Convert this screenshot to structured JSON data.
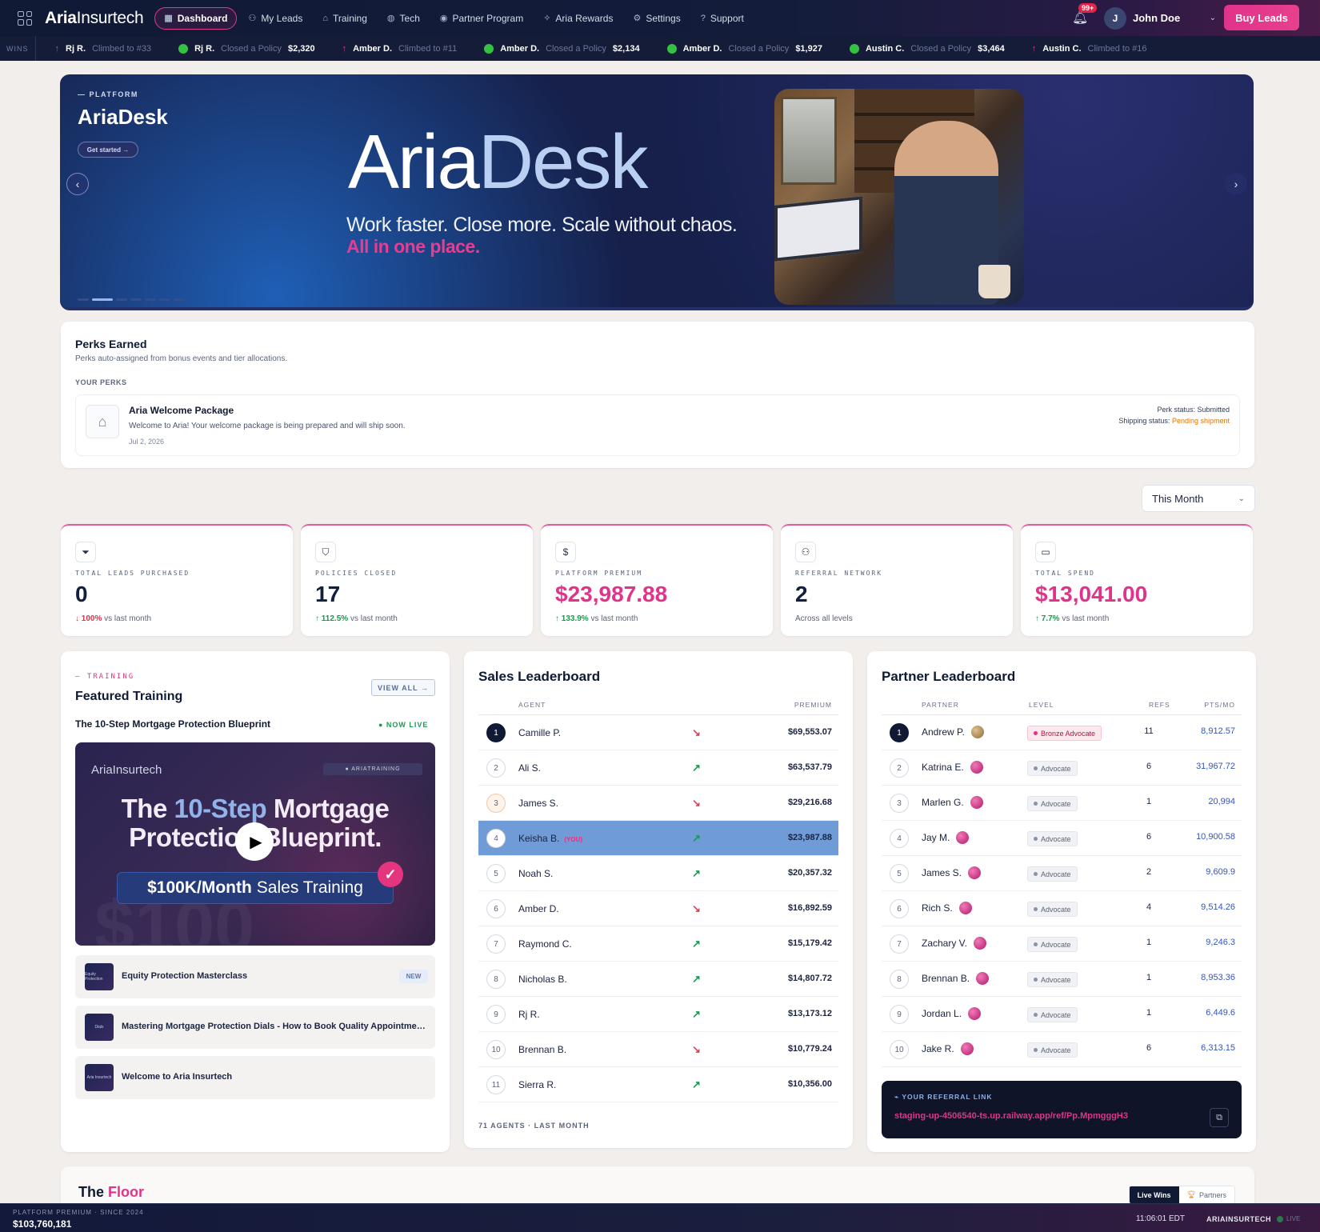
{
  "nav": {
    "brand_bold": "Aria",
    "brand_rest": "Insurtech",
    "items": [
      {
        "label": "Dashboard",
        "icon": "dashboard-icon",
        "active": true
      },
      {
        "label": "My Leads",
        "icon": "users-icon"
      },
      {
        "label": "Training",
        "icon": "graduation-cap-icon"
      },
      {
        "label": "Tech",
        "icon": "globe-icon"
      },
      {
        "label": "Partner Program",
        "icon": "user-circle-icon"
      },
      {
        "label": "Aria Rewards",
        "icon": "sparkles-icon"
      },
      {
        "label": "Settings",
        "icon": "gear-icon"
      },
      {
        "label": "Support",
        "icon": "help-circle-icon"
      }
    ],
    "notifications": "99+",
    "user_initial": "J",
    "user_name": "John Doe",
    "buy_label": "Buy Leads"
  },
  "ticker": {
    "label": "WINS",
    "items": [
      {
        "kind": "climb",
        "name": "Rj R.",
        "action": "Climbed to #33",
        "value": ""
      },
      {
        "kind": "close",
        "name": "Rj R.",
        "action": "Closed a Policy",
        "value": "$2,320"
      },
      {
        "kind": "climb",
        "name": "Amber D.",
        "action": "Climbed to #11",
        "value": ""
      },
      {
        "kind": "close",
        "name": "Amber D.",
        "action": "Closed a Policy",
        "value": "$2,134"
      },
      {
        "kind": "close",
        "name": "Amber D.",
        "action": "Closed a Policy",
        "value": "$1,927"
      },
      {
        "kind": "close",
        "name": "Austin C.",
        "action": "Closed a Policy",
        "value": "$3,464"
      },
      {
        "kind": "climb",
        "name": "Austin C.",
        "action": "Climbed to #16",
        "value": ""
      }
    ]
  },
  "hero": {
    "kicker": "— PLATFORM",
    "title": "AriaDesk",
    "cta": "Get started →",
    "big_aria": "Aria",
    "big_desk": "Desk",
    "subtitle": "Work faster. Close more. Scale without chaos.",
    "subtitle_accent": "All in one place.",
    "slides": 7,
    "active_slide": 2
  },
  "perks": {
    "title": "Perks Earned",
    "description": "Perks auto-assigned from bonus events and tier allocations.",
    "section_label": "YOUR PERKS",
    "item": {
      "title": "Aria Welcome Package",
      "description": "Welcome to Aria! Your welcome package is being prepared and will ship soon.",
      "date": "Jul 2, 2026",
      "status_label": "Perk status: Submitted",
      "shipping_label": "Shipping status:",
      "shipping_value": "Pending shipment"
    }
  },
  "period": {
    "selected": "This Month"
  },
  "stats": [
    {
      "label": "TOTAL LEADS PURCHASED",
      "value": "0",
      "change": "100%",
      "direction": "down",
      "suffix": "vs last month",
      "icon": "filter-icon",
      "accent": false
    },
    {
      "label": "POLICIES CLOSED",
      "value": "17",
      "change": "112.5%",
      "direction": "up",
      "suffix": "vs last month",
      "icon": "shield-icon",
      "accent": false
    },
    {
      "label": "PLATFORM PREMIUM",
      "value": "$23,987.88",
      "change": "133.9%",
      "direction": "up",
      "suffix": "vs last month",
      "icon": "dollar-icon",
      "accent": true
    },
    {
      "label": "REFERRAL NETWORK",
      "value": "2",
      "change": "",
      "direction": "none",
      "suffix": "Across all levels",
      "icon": "users-icon",
      "accent": false
    },
    {
      "label": "TOTAL SPEND",
      "value": "$13,041.00",
      "change": "7.7%",
      "direction": "up",
      "suffix": "vs last month",
      "icon": "wallet-icon",
      "accent": true
    }
  ],
  "training": {
    "kicker": "— TRAINING",
    "title": "Featured Training",
    "view_all": "VIEW ALL →",
    "featured_title": "The 10-Step Mortgage Protection Blueprint",
    "live_label": "● NOW LIVE",
    "video": {
      "logo": "AriaInsurtech",
      "tag": "● ARIATRAINING",
      "line1_a": "The",
      "line1_b": "10-Step",
      "line1_c": "Mortgage",
      "line2": "Protection Blueprint.",
      "bar_bold": "$100K/Month",
      "bar_rest": "Sales Training",
      "bg_text": "$100"
    },
    "courses": [
      {
        "title": "Equity Protection Masterclass",
        "badge": "NEW",
        "thumb": "Equity Protection"
      },
      {
        "title": "Mastering Mortgage Protection Dials - How to Book Quality Appointments",
        "badge": "",
        "thumb": "Dials"
      },
      {
        "title": "Welcome to Aria Insurtech",
        "badge": "",
        "thumb": "Aria Insurtech"
      }
    ]
  },
  "sales": {
    "title": "Sales Leaderboard",
    "col_agent": "AGENT",
    "col_premium": "PREMIUM",
    "rows": [
      {
        "rank": "1",
        "name": "Camille P.",
        "trend": "down",
        "premium": "$69,553.07"
      },
      {
        "rank": "2",
        "name": "Ali S.",
        "trend": "up",
        "premium": "$63,537.79"
      },
      {
        "rank": "3",
        "name": "James S.",
        "trend": "down",
        "premium": "$29,216.68"
      },
      {
        "rank": "4",
        "name": "Keisha B.",
        "trend": "up",
        "premium": "$23,987.88",
        "you": "(YOU)"
      },
      {
        "rank": "5",
        "name": "Noah S.",
        "trend": "up",
        "premium": "$20,357.32"
      },
      {
        "rank": "6",
        "name": "Amber D.",
        "trend": "down",
        "premium": "$16,892.59"
      },
      {
        "rank": "7",
        "name": "Raymond C.",
        "trend": "up",
        "premium": "$15,179.42"
      },
      {
        "rank": "8",
        "name": "Nicholas B.",
        "trend": "up",
        "premium": "$14,807.72"
      },
      {
        "rank": "9",
        "name": "Rj R.",
        "trend": "up",
        "premium": "$13,173.12"
      },
      {
        "rank": "10",
        "name": "Brennan B.",
        "trend": "down",
        "premium": "$10,779.24"
      },
      {
        "rank": "11",
        "name": "Sierra R.",
        "trend": "up",
        "premium": "$10,356.00"
      }
    ],
    "footer": "71 AGENTS · LAST MONTH"
  },
  "partner": {
    "title": "Partner Leaderboard",
    "col_partner": "PARTNER",
    "col_level": "LEVEL",
    "col_refs": "REFS",
    "col_pts": "PTS/MO",
    "rows": [
      {
        "rank": "1",
        "name": "Andrew P.",
        "level": "Bronze Advocate",
        "refs": "11",
        "pts": "8,912.57"
      },
      {
        "rank": "2",
        "name": "Katrina E.",
        "level": "Advocate",
        "refs": "6",
        "pts": "31,967.72"
      },
      {
        "rank": "3",
        "name": "Marlen G.",
        "level": "Advocate",
        "refs": "1",
        "pts": "20,994"
      },
      {
        "rank": "4",
        "name": "Jay M.",
        "level": "Advocate",
        "refs": "6",
        "pts": "10,900.58"
      },
      {
        "rank": "5",
        "name": "James S.",
        "level": "Advocate",
        "refs": "2",
        "pts": "9,609.9"
      },
      {
        "rank": "6",
        "name": "Rich S.",
        "level": "Advocate",
        "refs": "4",
        "pts": "9,514.26"
      },
      {
        "rank": "7",
        "name": "Zachary V.",
        "level": "Advocate",
        "refs": "1",
        "pts": "9,246.3"
      },
      {
        "rank": "8",
        "name": "Brennan B.",
        "level": "Advocate",
        "refs": "1",
        "pts": "8,953.36"
      },
      {
        "rank": "9",
        "name": "Jordan L.",
        "level": "Advocate",
        "refs": "1",
        "pts": "6,449.6"
      },
      {
        "rank": "10",
        "name": "Jake R.",
        "level": "Advocate",
        "refs": "6",
        "pts": "6,313.15"
      }
    ],
    "referral_label": "⌁ YOUR REFERRAL LINK",
    "referral_url": "staging-up-4506540-ts.up.railway.app/ref/Pp.MpmgggH3"
  },
  "floor": {
    "title_a": "The",
    "title_b": "Floor",
    "tab_live": "Live Wins",
    "tab_partners": "Partners"
  },
  "bottom": {
    "label": "PLATFORM PREMIUM · SINCE 2024",
    "value": "$103,760,181",
    "time": "11:06:01 EDT",
    "brand": "ARIAINSURTECH",
    "live": "LIVE"
  }
}
